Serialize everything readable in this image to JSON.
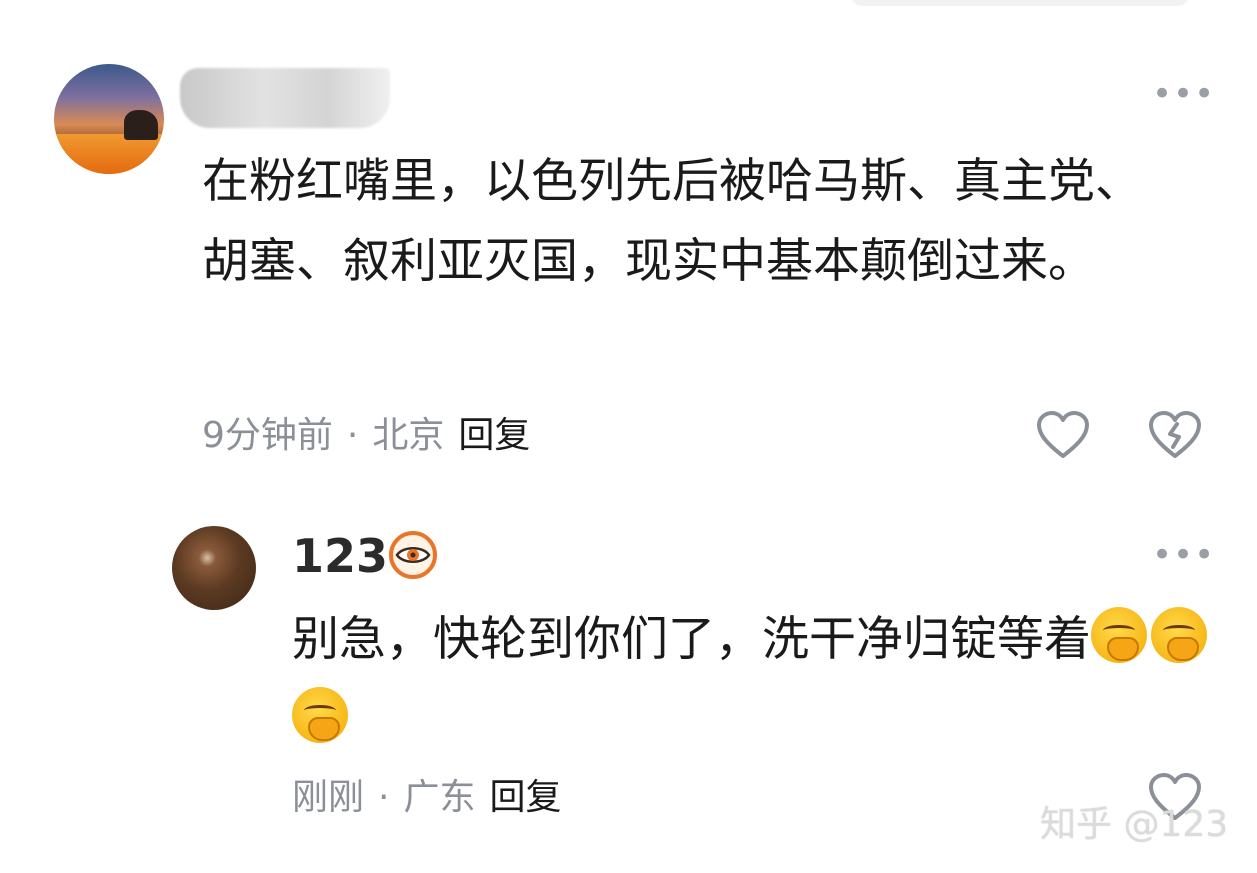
{
  "comments": [
    {
      "author": "",
      "text": "在粉红嘴里，以色列先后被哈马斯、真主党、胡塞、叙利亚灭国，现实中基本颠倒过来。",
      "time": "9分钟前",
      "separator": "·",
      "location": "北京",
      "reply_label": "回复",
      "icons": [
        "avatar-landscape",
        "more-icon",
        "heart-icon",
        "broken-heart-icon"
      ]
    },
    {
      "author": "123",
      "text": "别急，快轮到你们了，洗干净归锭等着",
      "emoji_count": 3,
      "emoji_name": "face-with-hand-over-mouth",
      "time": "刚刚",
      "separator": "·",
      "location": "广东",
      "reply_label": "回复",
      "icons": [
        "avatar-brown",
        "eye-badge-icon",
        "more-icon",
        "heart-icon"
      ]
    }
  ],
  "watermark": "知乎 @123",
  "colors": {
    "meta_gray": "#8a8f98",
    "text": "#1a1a1a",
    "badge_orange": "#e8752a",
    "emoji_yellow": "#f7b718"
  }
}
